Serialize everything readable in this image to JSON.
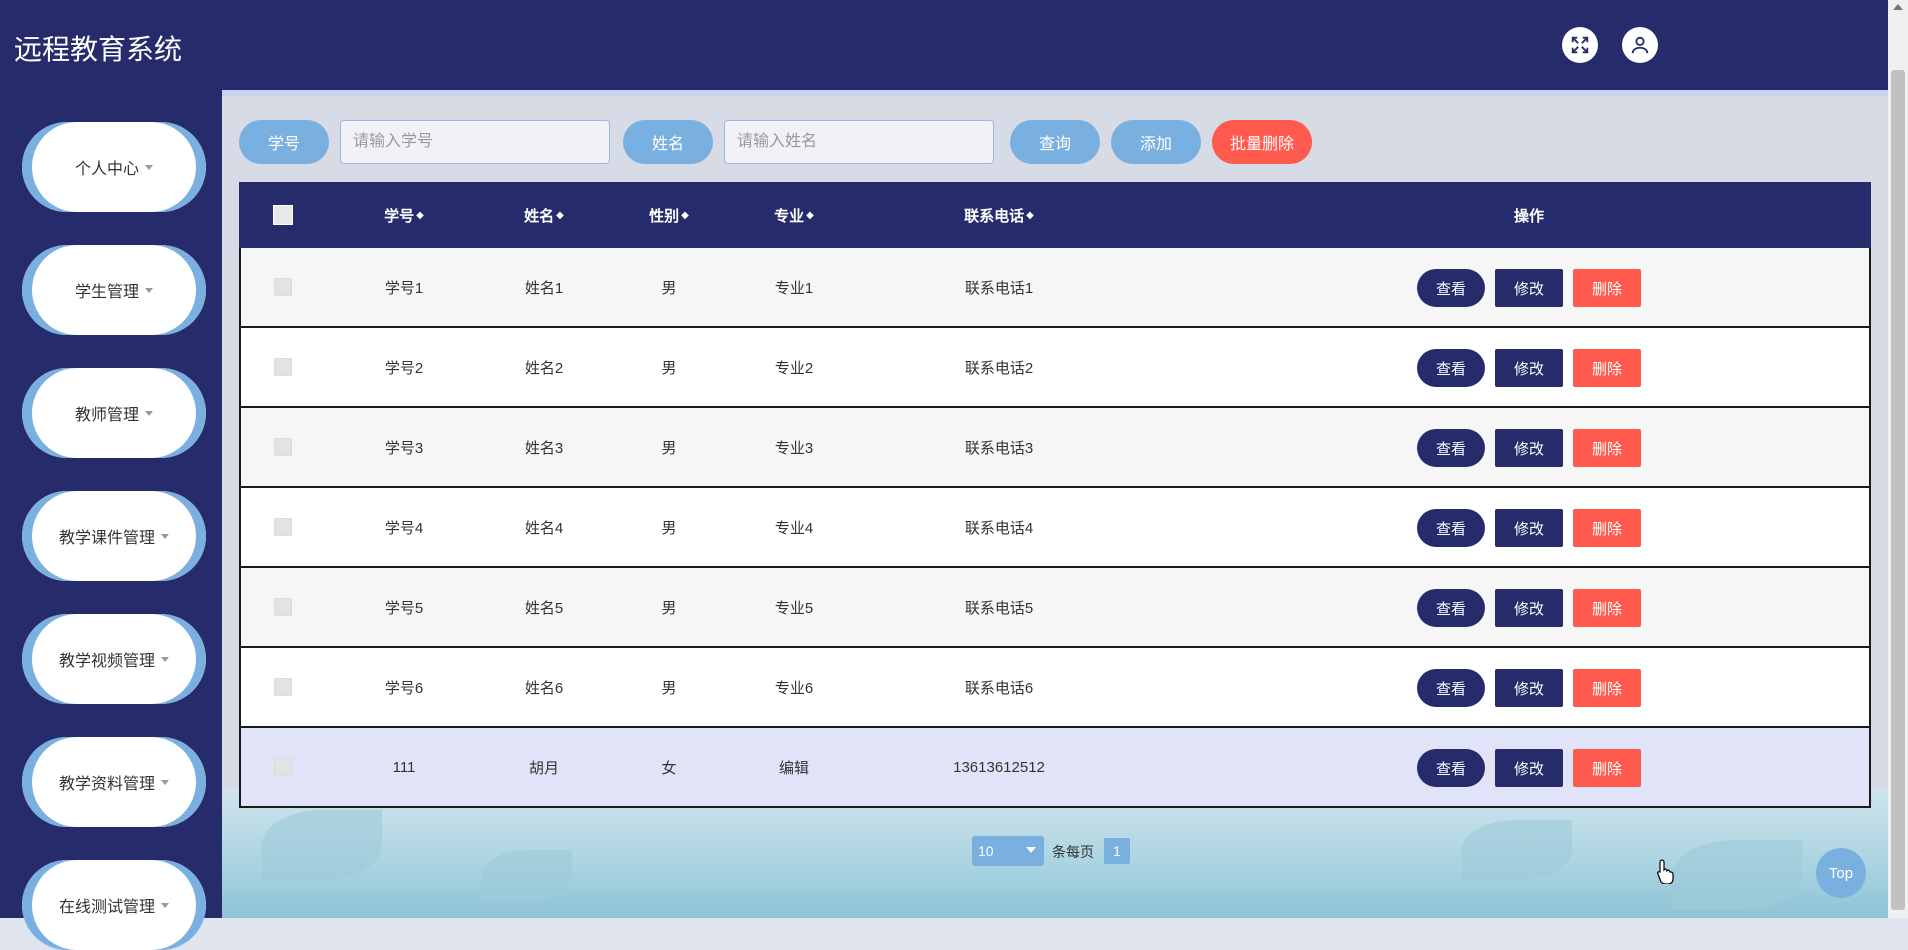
{
  "app": {
    "title": "远程教育系统"
  },
  "header": {
    "fullscreen_icon": "expand-icon",
    "user_icon": "user-icon"
  },
  "sidebar": {
    "items": [
      {
        "label": "个人中心"
      },
      {
        "label": "学生管理"
      },
      {
        "label": "教师管理"
      },
      {
        "label": "教学课件管理"
      },
      {
        "label": "教学视频管理"
      },
      {
        "label": "教学资料管理"
      },
      {
        "label": "在线测试管理"
      }
    ]
  },
  "search": {
    "id_label": "学号",
    "id_placeholder": "请输入学号",
    "name_label": "姓名",
    "name_placeholder": "请输入姓名",
    "query_button": "查询",
    "add_button": "添加",
    "batch_delete_button": "批量删除"
  },
  "table": {
    "columns": {
      "id": "学号",
      "name": "姓名",
      "gender": "性别",
      "major": "专业",
      "phone": "联系电话",
      "actions": "操作"
    },
    "sort_glyph": "◆",
    "actions": {
      "view": "查看",
      "edit": "修改",
      "delete": "删除"
    },
    "rows": [
      {
        "id": "学号1",
        "name": "姓名1",
        "gender": "男",
        "major": "专业1",
        "phone": "联系电话1"
      },
      {
        "id": "学号2",
        "name": "姓名2",
        "gender": "男",
        "major": "专业2",
        "phone": "联系电话2"
      },
      {
        "id": "学号3",
        "name": "姓名3",
        "gender": "男",
        "major": "专业3",
        "phone": "联系电话3"
      },
      {
        "id": "学号4",
        "name": "姓名4",
        "gender": "男",
        "major": "专业4",
        "phone": "联系电话4"
      },
      {
        "id": "学号5",
        "name": "姓名5",
        "gender": "男",
        "major": "专业5",
        "phone": "联系电话5"
      },
      {
        "id": "学号6",
        "name": "姓名6",
        "gender": "男",
        "major": "专业6",
        "phone": "联系电话6"
      },
      {
        "id": "111",
        "name": "胡月",
        "gender": "女",
        "major": "编辑",
        "phone": "13613612512"
      }
    ]
  },
  "pagination": {
    "page_size": "10",
    "per_page_label": "条每页",
    "current_page": "1"
  },
  "top_button": "Top",
  "colors": {
    "primary": "#262c6b",
    "accent": "#7ab0e0",
    "danger": "#ff5a4e"
  }
}
